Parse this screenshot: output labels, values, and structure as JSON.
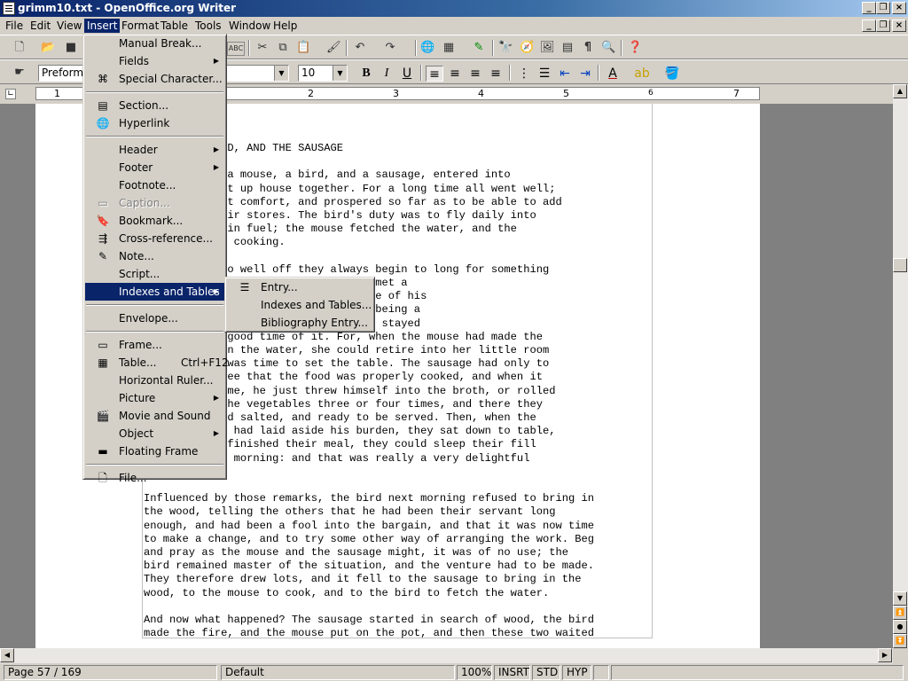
{
  "window": {
    "title": "grimm10.txt - OpenOffice.org Writer"
  },
  "menubar": [
    "File",
    "Edit",
    "View",
    "Insert",
    "Format",
    "Table",
    "Tools",
    "Window",
    "Help"
  ],
  "formatting": {
    "style": "Preformat",
    "size": "10"
  },
  "ruler": [
    "1",
    "2",
    "3",
    "4",
    "5",
    "6",
    "7"
  ],
  "insert_menu": [
    {
      "label": "Manual Break...",
      "icon": ""
    },
    {
      "label": "Fields",
      "icon": "",
      "sub": true
    },
    {
      "label": "Special Character...",
      "icon": "omega-icon"
    },
    {
      "sep": true
    },
    {
      "label": "Section...",
      "icon": "section-icon"
    },
    {
      "label": "Hyperlink",
      "icon": "hyperlink-icon"
    },
    {
      "sep": true
    },
    {
      "label": "Header",
      "icon": "",
      "sub": true
    },
    {
      "label": "Footer",
      "icon": "",
      "sub": true
    },
    {
      "label": "Footnote...",
      "icon": ""
    },
    {
      "label": "Caption...",
      "icon": "caption-icon",
      "disabled": true
    },
    {
      "label": "Bookmark...",
      "icon": "bookmark-icon"
    },
    {
      "label": "Cross-reference...",
      "icon": "cross-reference-icon"
    },
    {
      "label": "Note...",
      "icon": "note-icon"
    },
    {
      "label": "Script...",
      "icon": ""
    },
    {
      "label": "Indexes and Tables",
      "icon": "",
      "sub": true,
      "highlighted": true
    },
    {
      "sep": true
    },
    {
      "label": "Envelope...",
      "icon": ""
    },
    {
      "sep": true
    },
    {
      "label": "Frame...",
      "icon": "frame-icon"
    },
    {
      "label": "Table...",
      "icon": "table-icon",
      "shortcut": "Ctrl+F12"
    },
    {
      "label": "Horizontal Ruler...",
      "icon": ""
    },
    {
      "label": "Picture",
      "icon": "",
      "sub": true
    },
    {
      "label": "Movie and Sound",
      "icon": "movie-icon"
    },
    {
      "label": "Object",
      "icon": "",
      "sub": true
    },
    {
      "label": "Floating Frame",
      "icon": "floating-frame-icon"
    },
    {
      "sep": true
    },
    {
      "label": "File...",
      "icon": "file-icon"
    }
  ],
  "indexes_submenu": [
    {
      "label": "Entry...",
      "icon": "entry-icon"
    },
    {
      "label": "Indexes and Tables...",
      "icon": ""
    },
    {
      "label": "Bibliography Entry...",
      "icon": ""
    }
  ],
  "document_lines": [
    "       HE BIRD, AND THE SAUSAGE",
    "",
    "       time, a mouse, a bird, and a sausage, entered into",
    "       and set up house together. For a long time all went well;",
    "       n great comfort, and prospered so far as to be able to add",
    "       to their stores. The bird's duty was to fly daily into",
    "       bring in fuel; the mouse fetched the water, and the",
    "       to the cooking.",
    "",
    "       are too well off they always begin to long for something",
    "       the bird, while out one day, met a",
    "       y expatiated on the excellence of his",
    "       ther bird sneered at him for being a",
    "       ard work, while the other two stayed",
    "       had a good time of it. For, when the mouse had made the",
    "       ched in the water, she could retire into her little room",
    "       il it was time to set the table. The sausage had only to",
    "       t to see that the food was properly cooked, and when it",
    "       ner-time, he just threw himself into the broth, or rolled",
    "       mong the vegetables three or four times, and there they",
    "       ed, and salted, and ready to be served. Then, when the",
    "       me and had laid aside his burden, they sat down to table,",
    "       y had finished their meal, they could sleep their fill",
    "       lowing morning: and that was really a very delightful",
    "",
    "",
    "Influenced by those remarks, the bird next morning refused to bring in",
    "the wood, telling the others that he had been their servant long",
    "enough, and had been a fool into the bargain, and that it was now time",
    "to make a change, and to try some other way of arranging the work. Beg",
    "and pray as the mouse and the sausage might, it was of no use; the",
    "bird remained master of the situation, and the venture had to be made.",
    "They therefore drew lots, and it fell to the sausage to bring in the",
    "wood, to the mouse to cook, and to the bird to fetch the water.",
    "",
    "And now what happened? The sausage started in search of wood, the bird",
    "made the fire, and the mouse put on the pot, and then these two waited"
  ],
  "status": {
    "page": "Page 57 / 169",
    "style": "Default",
    "zoom": "100%",
    "insert": "INSRT",
    "sel": "STD",
    "hyp": "HYP"
  }
}
